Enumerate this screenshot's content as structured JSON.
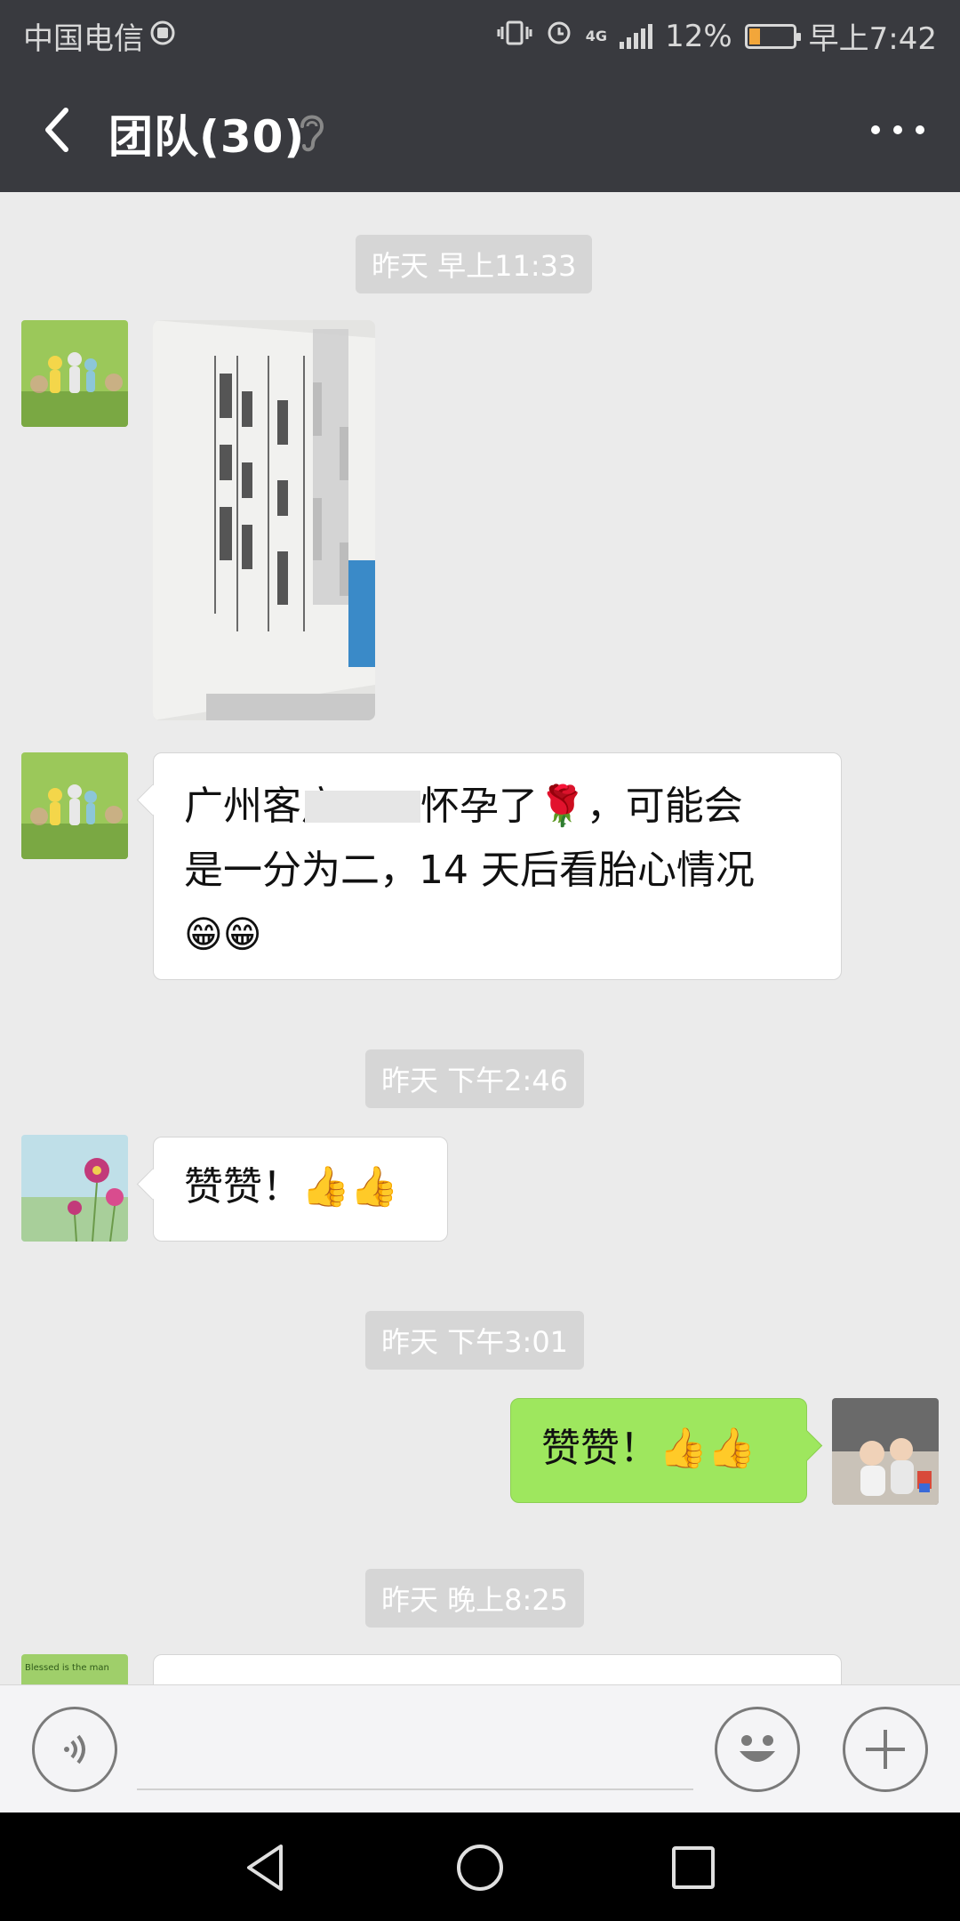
{
  "status_bar": {
    "carrier": "中国电信",
    "network": "4G",
    "battery": "12%",
    "time": "早上7:42",
    "battery_level": 0.12
  },
  "header": {
    "title": "团队(30)"
  },
  "messages": [
    {
      "type": "time",
      "text": "昨天 早上11:33"
    },
    {
      "type": "image",
      "sender": "other"
    },
    {
      "type": "text",
      "sender": "other",
      "line1": "广州客户",
      "line1b": "怀孕了🌹，可能会",
      "line2": "是一分为二，14 天后看胎心情况",
      "line3": "😁😁"
    },
    {
      "type": "time",
      "text": "昨天 下午2:46"
    },
    {
      "type": "text",
      "sender": "other",
      "text": "赞赞！👍👍"
    },
    {
      "type": "time",
      "text": "昨天 下午3:01"
    },
    {
      "type": "text",
      "sender": "me",
      "text": "赞赞！👍👍"
    },
    {
      "type": "time",
      "text": "昨天 晚上8:25"
    },
    {
      "type": "text",
      "sender": "other",
      "avatar_text": "Blessed is the man"
    }
  ],
  "colors": {
    "header_bg": "#393a3f",
    "chat_bg": "#ebebeb",
    "my_bubble": "#9ee75e",
    "other_bubble": "#ffffff",
    "time_pill": "#d6d6d6"
  }
}
